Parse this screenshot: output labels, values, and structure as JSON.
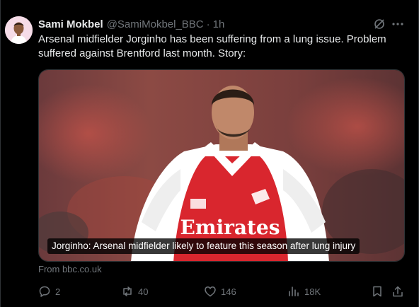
{
  "author": {
    "name": "Sami Mokbel",
    "handle": "@SamiMokbel_BBC",
    "separator": "·",
    "time": "1h"
  },
  "tweet": {
    "text": "Arsenal midfielder Jorginho has been suffering from a lung issue. Problem suffered against Brentford last month. Story:"
  },
  "media": {
    "caption": "Jorginho: Arsenal midfielder likely to feature this season after lung injury",
    "shirt_sponsor": "Emirates",
    "source": "From bbc.co.uk"
  },
  "actions": {
    "replies": "2",
    "reposts": "40",
    "likes": "146",
    "views": "18K"
  },
  "icons": [
    "grok-icon",
    "more-icon",
    "reply-icon",
    "repost-icon",
    "like-icon",
    "views-icon",
    "bookmark-icon",
    "share-icon"
  ],
  "colors": {
    "background": "#000000",
    "text": "#e7e9ea",
    "muted": "#71767b",
    "shirt_red": "#d9262e"
  }
}
